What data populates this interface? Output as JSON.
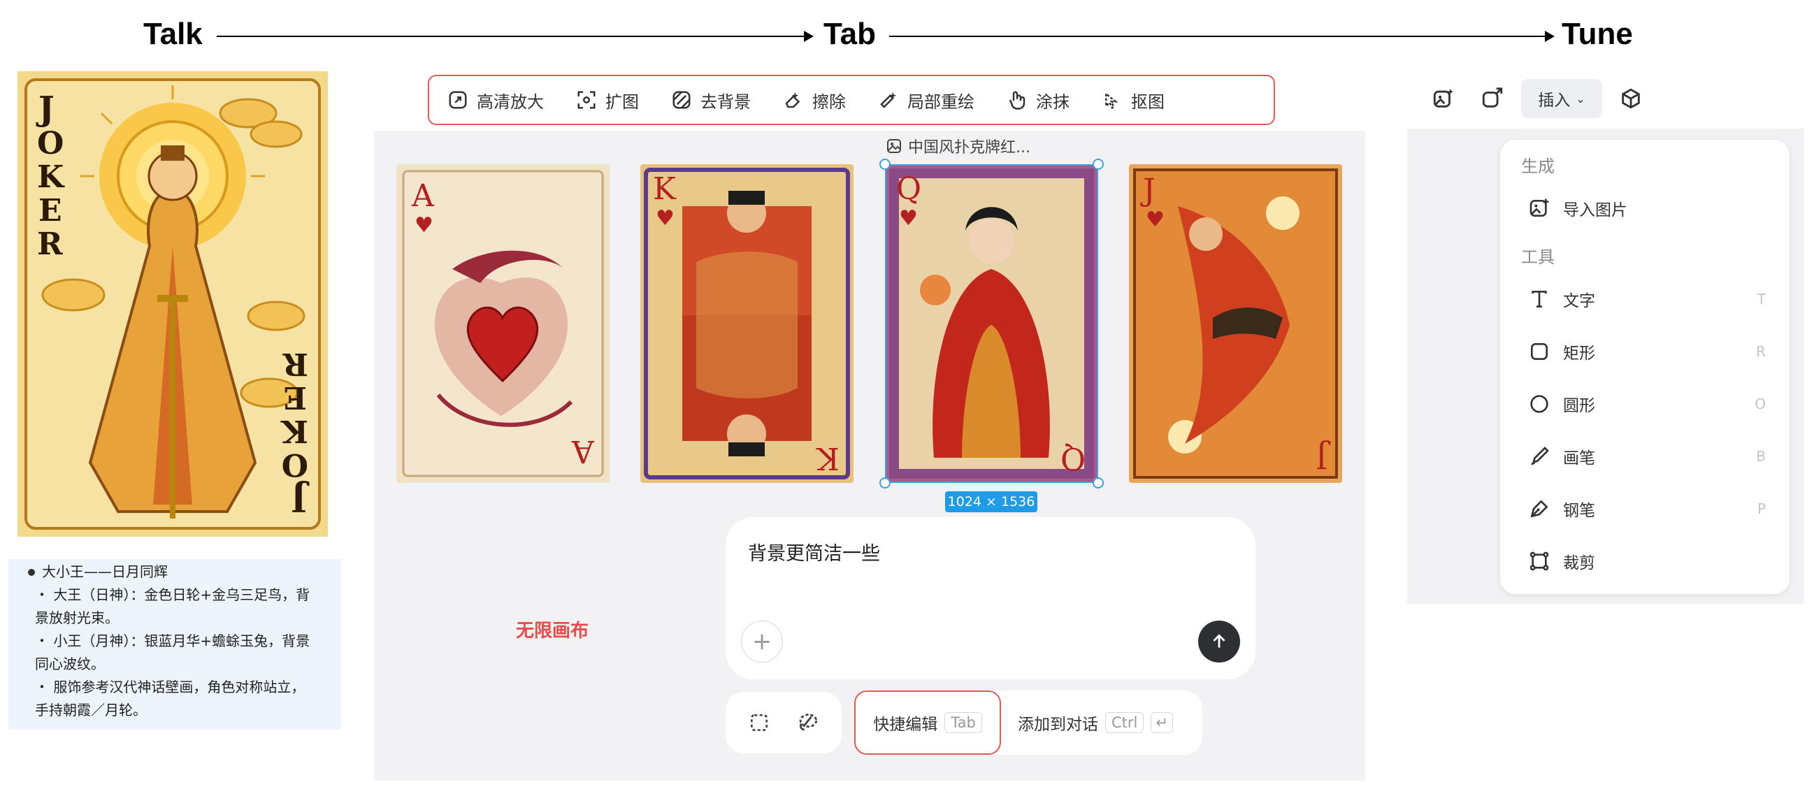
{
  "flow": {
    "talk": "Talk",
    "tab": "Tab",
    "tune": "Tune"
  },
  "talk": {
    "card": {
      "title_top": "JOKER",
      "title_bottom": "JOKER"
    },
    "notes": [
      {
        "type": "bullet",
        "text": "大小王——日月同辉"
      },
      {
        "type": "sub",
        "text": "・ 大王（日神）：金色日轮+金乌三足鸟，背"
      },
      {
        "type": "cont",
        "text": "景放射光束。"
      },
      {
        "type": "sub",
        "text": "・ 小王（月神）：银蓝月华+蟾蜍玉兔，背景"
      },
      {
        "type": "cont",
        "text": "同心波纹。"
      },
      {
        "type": "sub",
        "text": "・ 服饰参考汉代神话壁画，角色对称站立，"
      },
      {
        "type": "cont",
        "text": "手持朝霞／月轮。"
      }
    ]
  },
  "tab": {
    "toolbar": [
      {
        "label": "高清放大",
        "icon": "upscale-icon"
      },
      {
        "label": "扩图",
        "icon": "expand-icon"
      },
      {
        "label": "去背景",
        "icon": "remove-bg-icon"
      },
      {
        "label": "擦除",
        "icon": "erase-icon"
      },
      {
        "label": "局部重绘",
        "icon": "inpaint-icon"
      },
      {
        "label": "涂抹",
        "icon": "smudge-icon"
      },
      {
        "label": "抠图",
        "icon": "cutout-icon"
      }
    ],
    "image_label": "中国风扑克牌红...",
    "cards": [
      {
        "rank": "A",
        "suit": "♥"
      },
      {
        "rank": "K",
        "suit": "♥"
      },
      {
        "rank": "Q",
        "suit": "♥"
      },
      {
        "rank": "J",
        "suit": "♥"
      }
    ],
    "dimensions": "1024 × 1536",
    "canvas_label": "无限画布",
    "prompt": {
      "text": "背景更简洁一些"
    },
    "quick_edit": {
      "label": "快捷编辑",
      "key": "Tab"
    },
    "add_to_chat": {
      "label": "添加到对话",
      "key": "Ctrl"
    }
  },
  "tune": {
    "insert_label": "插入",
    "sections": {
      "generate": "生成",
      "tools": "工具"
    },
    "import_label": "导入图片",
    "tools": [
      {
        "label": "文字",
        "key": "T"
      },
      {
        "label": "矩形",
        "key": "R"
      },
      {
        "label": "圆形",
        "key": "O"
      },
      {
        "label": "画笔",
        "key": "B"
      },
      {
        "label": "钢笔",
        "key": "P"
      },
      {
        "label": "裁剪",
        "key": ""
      }
    ]
  },
  "colors": {
    "highlight_red": "#e45a5a",
    "selection_blue": "#3aa0e8",
    "badge_blue": "#1e9be9",
    "canvas_gray": "#f2f2f4"
  }
}
